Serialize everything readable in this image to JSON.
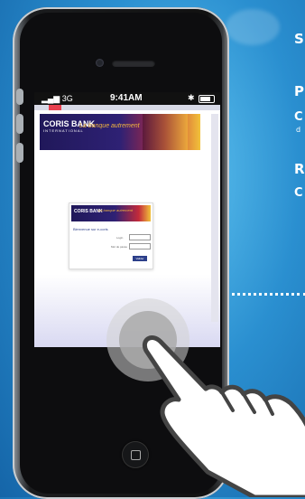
{
  "promo": {
    "lines": [
      "S",
      "P",
      "C",
      "d",
      "R",
      "C"
    ]
  },
  "device": {
    "carrier": "3G",
    "time": "9:41AM"
  },
  "website": {
    "brand": "CORIS BANK",
    "brand_sub": "INTERNATIONAL",
    "slogan": "La banque autrement",
    "login_heading": "Bienvenue sur e-coris",
    "login_label": "Login",
    "password_label": "Mot de passe",
    "submit_label": "Valider"
  }
}
